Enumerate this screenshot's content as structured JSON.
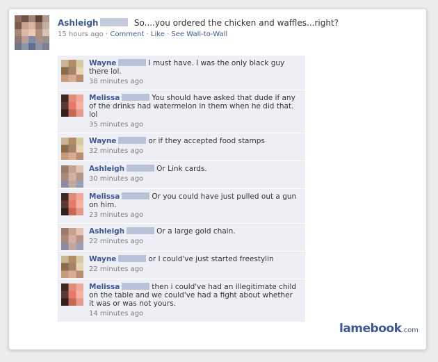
{
  "post": {
    "author": "Ashleigh",
    "text": "So....you ordered the chicken and waffles...right?",
    "time": "15 hours ago",
    "sep1": "·",
    "comment_link": "Comment",
    "sep2": "·",
    "like_link": "Like",
    "sep3": "·",
    "wall_link": "See Wall-to-Wall"
  },
  "comments": [
    {
      "name": "Wayne",
      "text": "I must have. I was the only black guy there lol.",
      "time": "38 minutes ago",
      "avatar": "wayne"
    },
    {
      "name": "Melissa",
      "text": "You should have asked that dude if any of the drinks had watermelon in them when he did that. lol",
      "time": "35 minutes ago",
      "avatar": "melissa"
    },
    {
      "name": "Wayne",
      "text": "or if they accepted food stamps",
      "time": "32 minutes ago",
      "avatar": "wayne"
    },
    {
      "name": "Ashleigh",
      "text": "Or Link cards.",
      "time": "30 minutes ago",
      "avatar": "ashleigh"
    },
    {
      "name": "Melissa",
      "text": "Or you could have just pulled out a gun on him.",
      "time": "23 minutes ago",
      "avatar": "melissa"
    },
    {
      "name": "Ashleigh",
      "text": "Or a large gold chain.",
      "time": "22 minutes ago",
      "avatar": "ashleigh"
    },
    {
      "name": "Wayne",
      "text": "or I could've just started freestylin",
      "time": "22 minutes ago",
      "avatar": "wayne"
    },
    {
      "name": "Melissa",
      "text": "then i could've had an illegitimate child on the table and we could've had a fight about whether it was or was not yours.",
      "time": "14 minutes ago",
      "avatar": "melissa"
    }
  ],
  "watermark": {
    "main": "lamebook",
    "suffix": ".com"
  },
  "colors": {
    "link": "#3b5998",
    "comment_bg": "#edeff4",
    "meta": "#808080"
  }
}
